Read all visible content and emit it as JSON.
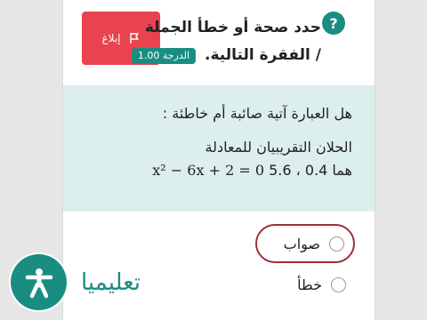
{
  "question": {
    "title_line1": "حدد صحة أو خطأ الجملة",
    "title_line2": "/ الفقرة التالية.",
    "grade_label": "الدرجة 1.00",
    "report_label": "إبلاغ",
    "help_icon": "?"
  },
  "content": {
    "prompt": "هل العبارة آتية صائبة أم خاطئة :",
    "line1": "الحلان التقريبيان للمعادلة",
    "equation_lhs": "x² − 6x + 2 = 0",
    "line2_text": "هما 0.4 ، 5.6"
  },
  "options": [
    {
      "label": "صواب",
      "selected": true
    },
    {
      "label": "خطأ",
      "selected": false
    }
  ],
  "brand": {
    "name": "تعليميا"
  },
  "colors": {
    "accent": "#1a8d82",
    "report": "#e8434e",
    "highlight": "#9c2f3c",
    "content_bg": "#dcefed"
  }
}
